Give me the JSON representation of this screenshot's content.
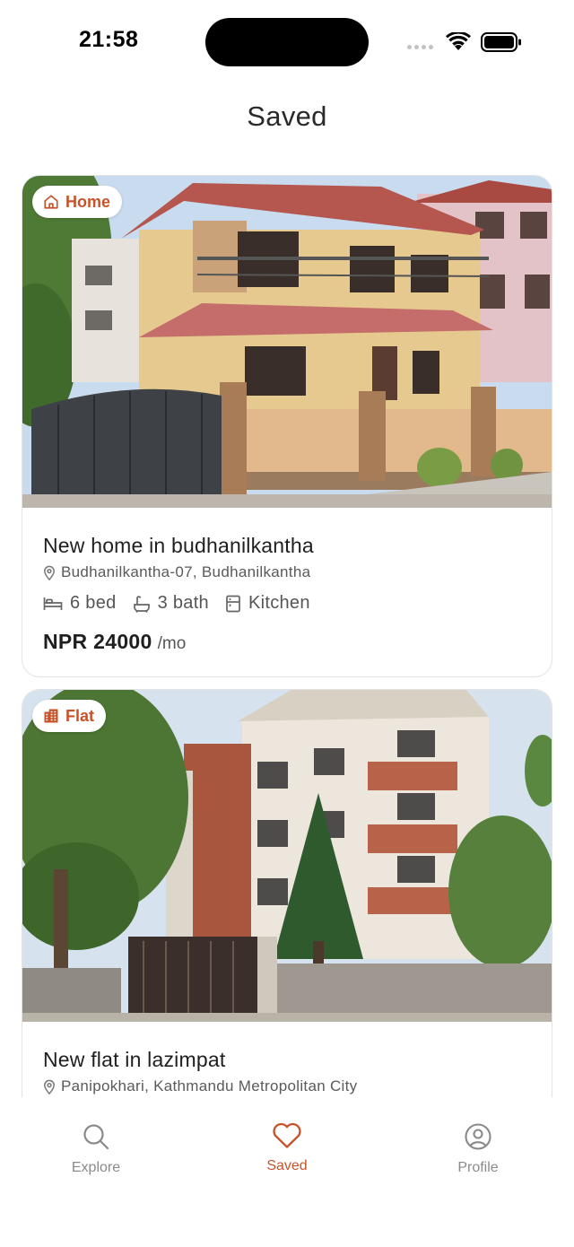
{
  "status_bar": {
    "time": "21:58"
  },
  "header": {
    "title": "Saved"
  },
  "listings": [
    {
      "badge": "Home",
      "badge_icon": "home-icon",
      "title": "New home in budhanilkantha",
      "address": "Budhanilkantha-07, Budhanilkantha",
      "beds": "6 bed",
      "baths": "3 bath",
      "kitchen": "Kitchen",
      "price": "NPR 24000",
      "period": "/mo"
    },
    {
      "badge": "Flat",
      "badge_icon": "building-icon",
      "title": "New flat in lazimpat",
      "address": "Panipokhari, Kathmandu Metropolitan City"
    }
  ],
  "tab_bar": {
    "tabs": [
      {
        "label": "Explore",
        "icon": "search-icon",
        "active": false
      },
      {
        "label": "Saved",
        "icon": "heart-icon",
        "active": true
      },
      {
        "label": "Profile",
        "icon": "user-circle-icon",
        "active": false
      }
    ]
  },
  "colors": {
    "accent": "#c8532a",
    "muted": "#8a8a8a",
    "text": "#1f1f1f"
  }
}
